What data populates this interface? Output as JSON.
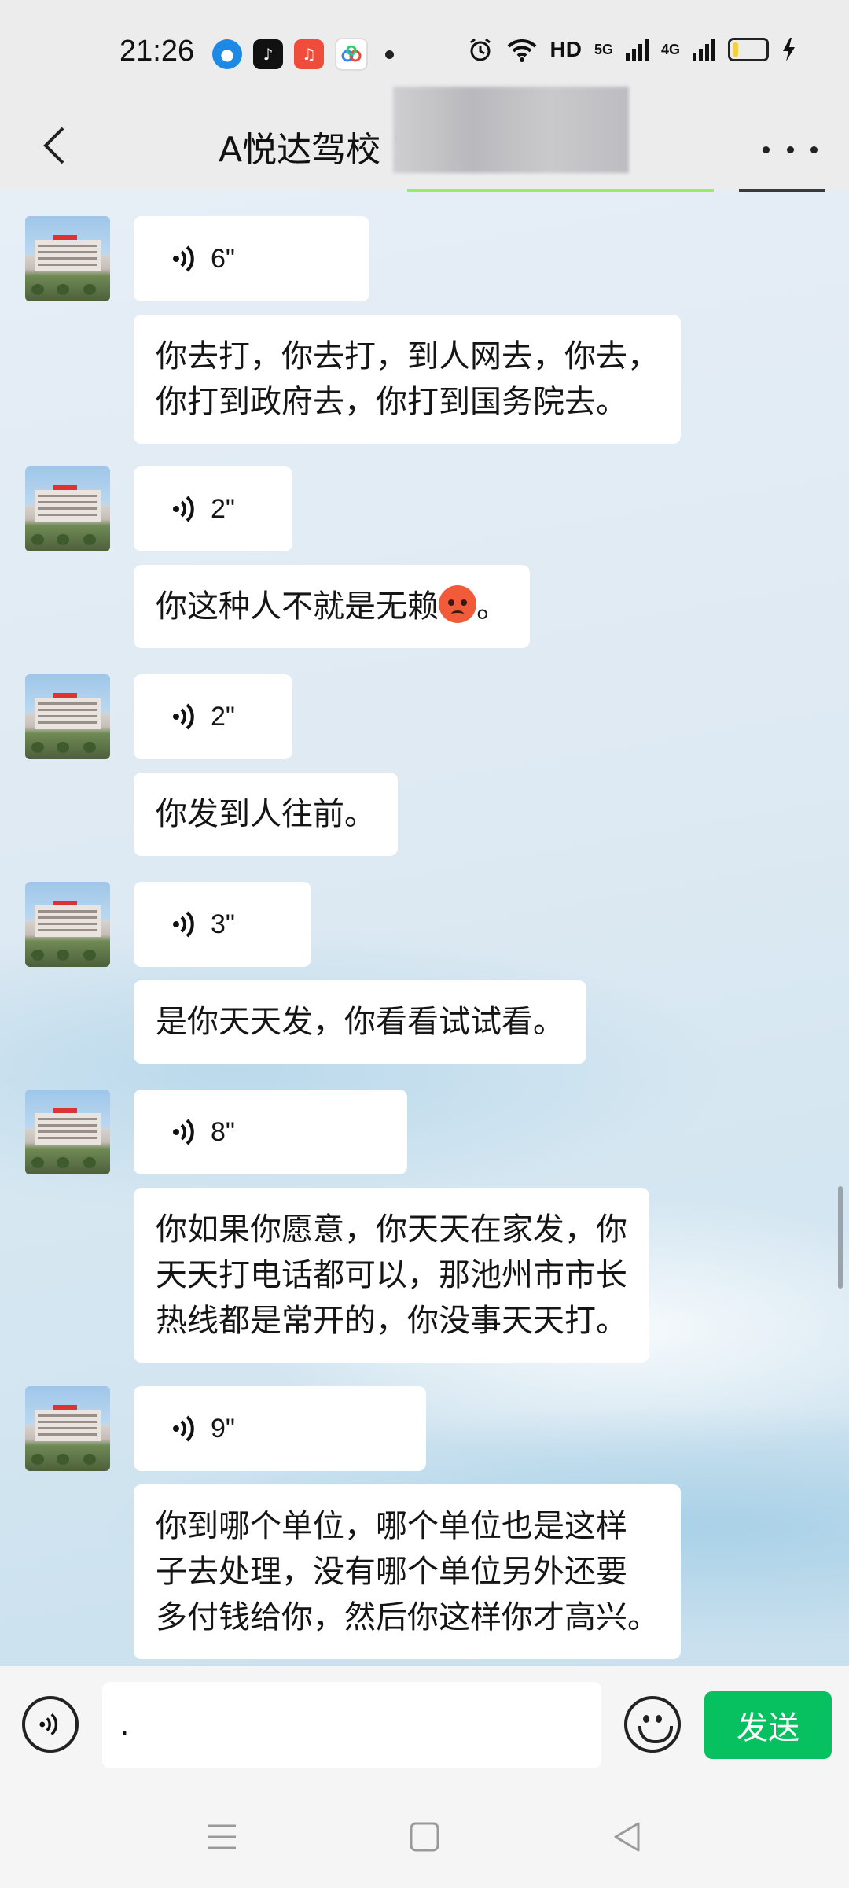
{
  "status_bar": {
    "time": "21:26",
    "network_hd": "HD",
    "net_5g": "5G",
    "net_4g": "4G",
    "battery_level": 0.2,
    "icons": [
      "app-circle-icon",
      "tiktok-icon",
      "music-icon",
      "cloud-app-icon",
      "alarm-icon",
      "wifi-icon",
      "signal-icon",
      "battery-icon",
      "charging-icon"
    ]
  },
  "nav": {
    "title": "A悦达驾校 1",
    "back_icon": "chevron-left-icon",
    "more_icon": "more-dots-icon"
  },
  "messages": [
    {
      "type": "voice",
      "duration": "6\""
    },
    {
      "type": "text",
      "lines": [
        "你去打，你去打，到人网去，你去，",
        "你打到政府去，你打到国务院去。"
      ]
    },
    {
      "type": "voice",
      "duration": "2\""
    },
    {
      "type": "text",
      "lines": [
        "你这种人不就是无赖"
      ],
      "suffix": "。",
      "emoji": "angry-face-emoji"
    },
    {
      "type": "voice",
      "duration": "2\""
    },
    {
      "type": "text",
      "lines": [
        "你发到人往前。"
      ]
    },
    {
      "type": "voice",
      "duration": "3\""
    },
    {
      "type": "text",
      "lines": [
        "是你天天发，你看看试试看。"
      ]
    },
    {
      "type": "voice",
      "duration": "8\""
    },
    {
      "type": "text",
      "lines": [
        "你如果你愿意，你天天在家发，你",
        "天天打电话都可以，那池州市市长",
        "热线都是常开的，你没事天天打。"
      ]
    },
    {
      "type": "voice",
      "duration": "9\""
    },
    {
      "type": "text",
      "lines": [
        "你到哪个单位，哪个单位也是这样",
        "子去处理，没有哪个单位另外还要",
        "多付钱给你，然后你这样你才高兴。"
      ]
    }
  ],
  "input": {
    "value": ".",
    "send_label": "发送"
  },
  "colors": {
    "send": "#07c160",
    "bubble": "#ffffff",
    "bar": "#ececed"
  }
}
